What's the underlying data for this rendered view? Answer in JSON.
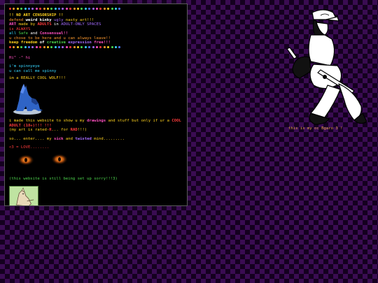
{
  "page": {
    "headline": "!! NO ART CENSORSHIP !!",
    "line2": {
      "a": "defend ",
      "b": "weird kinky ",
      "c": "ugly ",
      "d": "nasty art!!!"
    },
    "line3": {
      "a": "ART ",
      "b": "made by ",
      "c": "ADULTS ",
      "d": "in ",
      "e": "ADULT-ONLY SPACES"
    },
    "line4": "is ALWAYS",
    "line5": {
      "a": "all ",
      "b": "Safe ",
      "c": "and ",
      "d": "Consensual!!"
    },
    "line6": "u chose to be here and u can always leave!!",
    "line7": {
      "a": "keep freedom ",
      "b": "of ",
      "c": "creative ",
      "d": "expression ",
      "e": "free!!!"
    },
    "greeting": "Hi^ -^ hi",
    "name_line": "i'm spinnyeye",
    "callme": "u can call me spinny",
    "wolf_line": "im a REALLY COOL WOLF!!!",
    "about1": {
      "a": "i made this website to show u my ",
      "b": "drawings",
      "c": " and stuff but only if ur a ",
      "d": "COOL"
    },
    "about2": "ADULT (18+)!!! !!!",
    "about3": {
      "a": "(my art is rated-",
      "b": "R",
      "c": "... for ",
      "d": "RAD",
      "e": "!!!)"
    },
    "enter": {
      "a": "so... enter.... my ",
      "b": "sick",
      "c": " and ",
      "d": "twisted",
      "e": " mind........."
    },
    "lt3": "<3 = LOVE........",
    "setup": "(this website is still being set up sorry!!!3)",
    "caption": "this is my oc Bgaro 3 !"
  },
  "colors": {
    "red": "#ff3b3b",
    "yellow": "#ffd21e",
    "green": "#4ed84e",
    "cyan": "#37d7ff",
    "pink": "#ff4fc0",
    "orange": "#ff9a2e",
    "purple": "#a56bff",
    "blue": "#4f7bff",
    "white": "#ffffff",
    "caption": "#e8a34d"
  },
  "icons": {
    "divider": "rainbow-dot-divider",
    "wolf": "howling-blue-wolf-icon",
    "eyes": "glowing-eyes-image",
    "stamp": "cartoon-animal-stamp",
    "oc": "oc-character-playing-guitar"
  }
}
